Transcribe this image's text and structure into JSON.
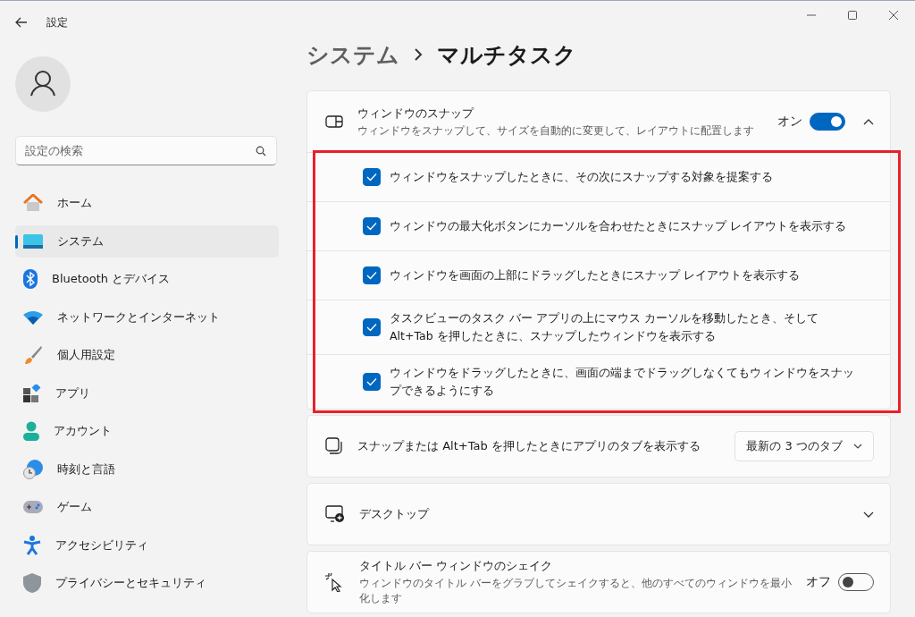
{
  "window": {
    "title": "設定"
  },
  "search": {
    "placeholder": "設定の検索"
  },
  "nav": [
    {
      "label": "ホーム",
      "selected": false
    },
    {
      "label": "システム",
      "selected": true
    },
    {
      "label": "Bluetooth とデバイス",
      "selected": false
    },
    {
      "label": "ネットワークとインターネット",
      "selected": false
    },
    {
      "label": "個人用設定",
      "selected": false
    },
    {
      "label": "アプリ",
      "selected": false
    },
    {
      "label": "アカウント",
      "selected": false
    },
    {
      "label": "時刻と言語",
      "selected": false
    },
    {
      "label": "ゲーム",
      "selected": false
    },
    {
      "label": "アクセシビリティ",
      "selected": false
    },
    {
      "label": "プライバシーとセキュリティ",
      "selected": false
    }
  ],
  "breadcrumb": [
    "システム",
    "マルチタスク"
  ],
  "sections": [
    {
      "kind": "expander",
      "title": "ウィンドウのスナップ",
      "description": "ウィンドウをスナップして、サイズを自動的に変更して、レイアウトに配置します",
      "toggle": {
        "label": "オン",
        "on": true
      },
      "expanded": true,
      "highlighted": true,
      "options": [
        {
          "label": "ウィンドウをスナップしたときに、その次にスナップする対象を提案する",
          "checked": true
        },
        {
          "label": "ウィンドウの最大化ボタンにカーソルを合わせたときにスナップ レイアウトを表示する",
          "checked": true
        },
        {
          "label": "ウィンドウを画面の上部にドラッグしたときにスナップ レイアウトを表示する",
          "checked": true
        },
        {
          "label": "タスクビューのタスク バー アプリの上にマウス カーソルを移動したとき、そして Alt+Tab を押したときに、スナップしたウィンドウを表示する",
          "checked": true
        },
        {
          "label": "ウィンドウをドラッグしたときに、画面の端までドラッグしなくてもウィンドウをスナップできるようにする",
          "checked": true
        }
      ]
    },
    {
      "kind": "dropdown",
      "title": "スナップまたは Alt+Tab を押したときにアプリのタブを表示する",
      "dropdown": {
        "value": "最新の 3 つのタブ"
      }
    },
    {
      "kind": "expander",
      "title": "デスクトップ",
      "expanded": false
    },
    {
      "kind": "toggle",
      "title": "タイトル バー ウィンドウのシェイク",
      "description": "ウィンドウのタイトル バーをグラブしてシェイクすると、他のすべてのウィンドウを最小化します",
      "toggle": {
        "label": "オフ",
        "on": false
      }
    }
  ]
}
